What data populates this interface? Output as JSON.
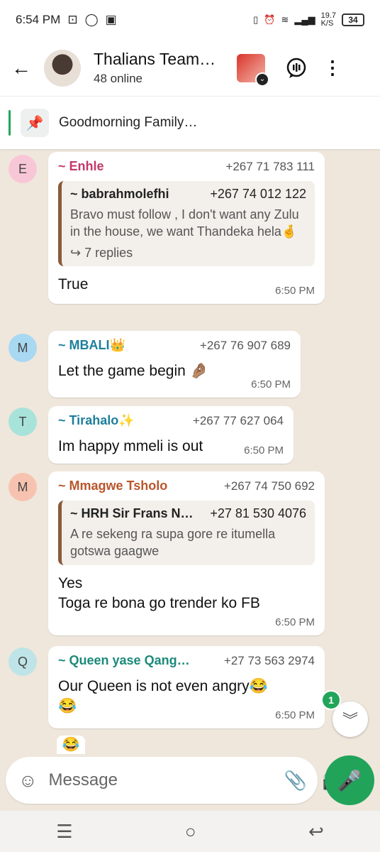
{
  "status_bar": {
    "time": "6:54 PM",
    "net_speed": "19.7",
    "net_unit": "K/S",
    "battery": "34"
  },
  "header": {
    "title": "Thalians Team…",
    "subtitle": "48 online"
  },
  "pinned": {
    "text": "Goodmorning Family…"
  },
  "messages": [
    {
      "avatar": "E",
      "avatar_color": "#f8c7d7",
      "sender": "~ Enhle",
      "sender_color": "#c5376b",
      "phone": "+267 71 783 111",
      "quote": {
        "name": "~ babrahmolefhi",
        "phone": "+267 74 012 122",
        "text": "Bravo must follow , I don't want any Zulu in the house, we want Thandeka hela🤞",
        "replies": "↪ 7 replies"
      },
      "text": "True",
      "time": "6:50 PM"
    },
    {
      "avatar": "M",
      "avatar_color": "#a8d8f2",
      "sender": "~ MBALI👑",
      "sender_color": "#1d7f9c",
      "phone": "+267 76 907 689",
      "text": "Let the game begin 🤌🏽",
      "time": "6:50 PM"
    },
    {
      "avatar": "T",
      "avatar_color": "#a8e3da",
      "sender": "~ Tirahalo✨",
      "sender_color": "#1d7f9c",
      "phone": "+267 77 627 064",
      "text": "Im happy mmeli is out",
      "time": "6:50 PM"
    },
    {
      "avatar": "M",
      "avatar_color": "#f7c3b0",
      "sender": "~ Mmagwe Tsholo",
      "sender_color": "#b8562b",
      "phone": "+267 74 750 692",
      "quote": {
        "name": "~ HRH Sir Frans N…",
        "phone": "+27 81 530 4076",
        "text": "A re sekeng ra supa gore re itumella gotswa gaagwe"
      },
      "text_lines": [
        "Yes",
        "Toga re bona go trender ko FB"
      ],
      "time": "6:50 PM"
    },
    {
      "avatar": "Q",
      "avatar_color": "#bfe4e7",
      "sender": "~ Queen yase Qang…",
      "sender_color": "#1b8a7a",
      "phone": "+27 73 563 2974",
      "text_lines": [
        "Our Queen is not even angry😂",
        "😂"
      ],
      "time": "6:50 PM"
    }
  ],
  "partial_emoji": "😂",
  "unread_count": "1",
  "composer": {
    "placeholder": "Message"
  },
  "icons": {
    "back": "arrow-left",
    "status": "channel-status",
    "menu": "more-vertical",
    "pin": "pin",
    "emoji": "sticker-smile",
    "attach": "paperclip",
    "camera": "camera",
    "mic": "microphone",
    "scroll": "double-chevron-down",
    "nav_recent": "menu-lines",
    "nav_home": "circle",
    "nav_back": "return-arrow"
  },
  "colors": {
    "accent_green": "#21a35a",
    "chat_bg": "#efe7dc"
  }
}
